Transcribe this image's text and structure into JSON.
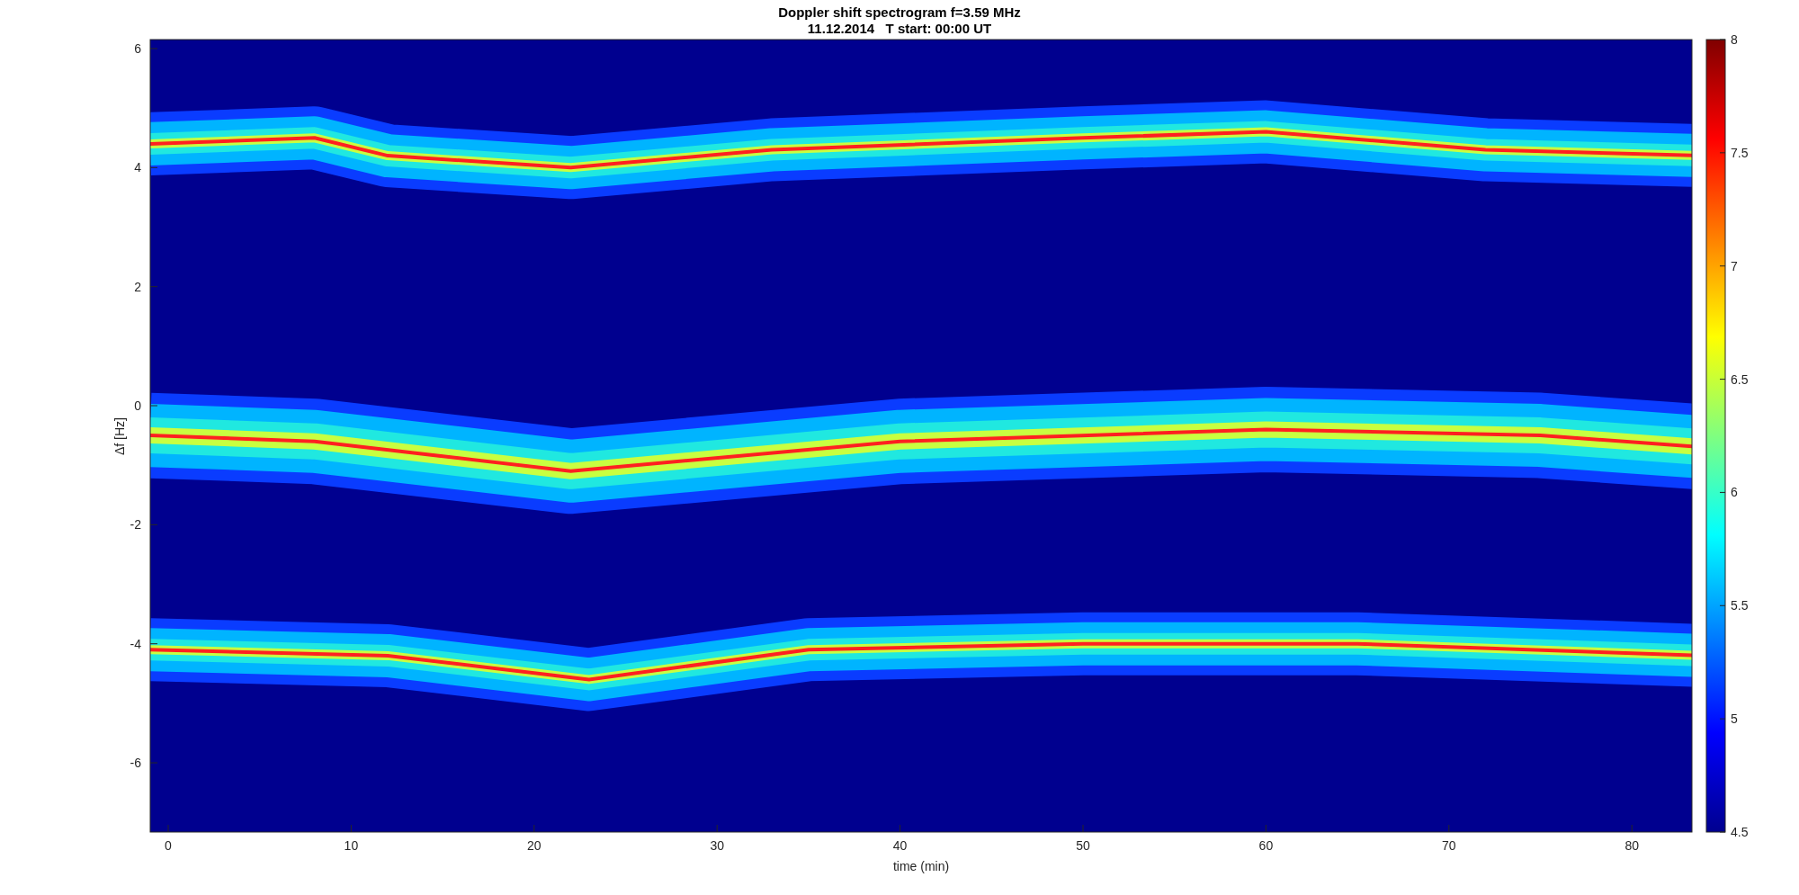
{
  "figure": {
    "title": "Doppler shift spectrogram f=3.59 MHz",
    "subtitle": "11.12.2014   T start: 00:00 UT",
    "xlabel": "time (min)",
    "ylabel": "Δf [Hz]",
    "xticks": [
      "0",
      "10",
      "20",
      "30",
      "40",
      "50",
      "60",
      "70",
      "80"
    ],
    "yticks": [
      "6",
      "4",
      "2",
      "0",
      "-2",
      "-4",
      "-6"
    ],
    "colorbar_ticks": [
      "8",
      "7.5",
      "7",
      "6.5",
      "6",
      "5.5",
      "5",
      "4.5"
    ]
  }
}
